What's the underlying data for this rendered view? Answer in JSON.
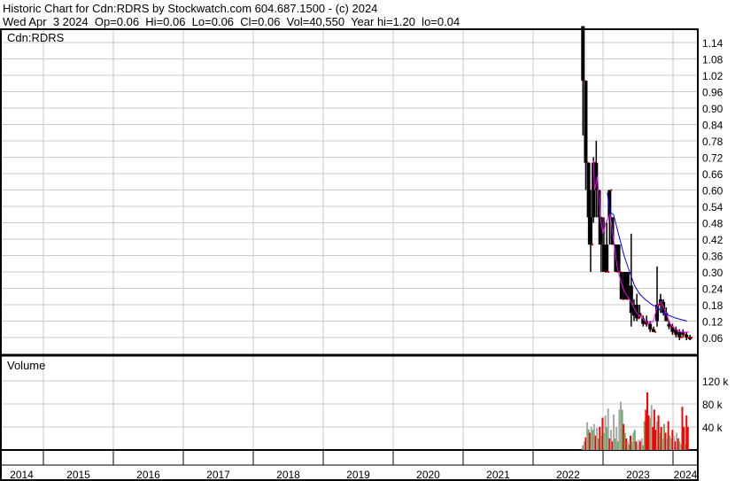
{
  "header": {
    "title": "Historic Chart for Cdn:RDRS by Stockwatch.com 604.687.1500 - (c) 2024",
    "quote": "Wed Apr  3 2024  Op=0.06  Hi=0.06  Lo=0.06  Cl=0.06  Vol=40,550  Year hi=1.20  lo=0.04"
  },
  "chart_data": [
    {
      "type": "ohlc",
      "title": "Cdn:RDRS",
      "ylim": [
        0.03,
        1.2
      ],
      "yticks": [
        "0.06",
        "0.12",
        "0.18",
        "0.24",
        "0.30",
        "0.36",
        "0.42",
        "0.48",
        "0.54",
        "0.60",
        "0.66",
        "0.72",
        "0.78",
        "0.84",
        "0.90",
        "0.96",
        "1.02",
        "1.08",
        "1.14"
      ],
      "bars": [
        [
          2022.7,
          1.2,
          0.8,
          1.2,
          1.0
        ],
        [
          2022.74,
          1.0,
          0.6,
          1.0,
          0.7
        ],
        [
          2022.78,
          0.7,
          0.4,
          0.7,
          0.5
        ],
        [
          2022.81,
          0.6,
          0.3,
          0.5,
          0.4
        ],
        [
          2022.85,
          0.72,
          0.48,
          0.5,
          0.7
        ],
        [
          2022.89,
          0.78,
          0.5,
          0.7,
          0.6
        ],
        [
          2022.93,
          0.6,
          0.4,
          0.6,
          0.5
        ],
        [
          2022.96,
          0.5,
          0.3,
          0.5,
          0.4
        ],
        [
          2023.0,
          0.5,
          0.3,
          0.4,
          0.3
        ],
        [
          2023.04,
          0.48,
          0.3,
          0.4,
          0.3
        ],
        [
          2023.08,
          0.6,
          0.4,
          0.5,
          0.6
        ],
        [
          2023.12,
          0.5,
          0.4,
          0.5,
          0.4
        ],
        [
          2023.17,
          0.4,
          0.3,
          0.4,
          0.3
        ],
        [
          2023.21,
          0.4,
          0.3,
          0.4,
          0.3
        ],
        [
          2023.25,
          0.3,
          0.2,
          0.3,
          0.2
        ],
        [
          2023.3,
          0.3,
          0.2,
          0.3,
          0.2
        ],
        [
          2023.34,
          0.3,
          0.2,
          0.3,
          0.2
        ],
        [
          2023.39,
          0.44,
          0.1,
          0.25,
          0.15
        ],
        [
          2023.43,
          0.2,
          0.12,
          0.18,
          0.14
        ],
        [
          2023.47,
          0.22,
          0.12,
          0.18,
          0.13
        ],
        [
          2023.51,
          0.18,
          0.13,
          0.15,
          0.14
        ],
        [
          2023.56,
          0.14,
          0.1,
          0.13,
          0.11
        ],
        [
          2023.61,
          0.14,
          0.1,
          0.12,
          0.11
        ],
        [
          2023.66,
          0.12,
          0.08,
          0.11,
          0.09
        ],
        [
          2023.71,
          0.1,
          0.08,
          0.09,
          0.08
        ],
        [
          2023.76,
          0.32,
          0.1,
          0.12,
          0.18
        ],
        [
          2023.81,
          0.22,
          0.15,
          0.2,
          0.18
        ],
        [
          2023.85,
          0.2,
          0.14,
          0.19,
          0.15
        ],
        [
          2023.89,
          0.17,
          0.12,
          0.15,
          0.12
        ],
        [
          2023.93,
          0.12,
          0.09,
          0.11,
          0.1
        ],
        [
          2023.98,
          0.11,
          0.07,
          0.1,
          0.08
        ],
        [
          2024.03,
          0.1,
          0.06,
          0.09,
          0.07
        ],
        [
          2024.08,
          0.09,
          0.05,
          0.08,
          0.06
        ],
        [
          2024.13,
          0.09,
          0.06,
          0.08,
          0.07
        ],
        [
          2024.18,
          0.08,
          0.05,
          0.07,
          0.06
        ],
        [
          2024.23,
          0.07,
          0.05,
          0.06,
          0.06
        ]
      ],
      "ma_short": {
        "color": "#ff00ff",
        "points": [
          [
            2022.86,
            0.71
          ],
          [
            2022.88,
            0.6
          ],
          [
            2022.92,
            0.65
          ],
          [
            2022.96,
            0.5
          ],
          [
            2023.0,
            0.44
          ],
          [
            2023.04,
            0.48
          ],
          [
            2023.1,
            0.51
          ],
          [
            2023.15,
            0.42
          ],
          [
            2023.2,
            0.32
          ],
          [
            2023.25,
            0.27
          ],
          [
            2023.3,
            0.23
          ],
          [
            2023.35,
            0.21
          ],
          [
            2023.4,
            0.19
          ],
          [
            2023.48,
            0.15
          ],
          [
            2023.56,
            0.13
          ],
          [
            2023.65,
            0.11
          ],
          [
            2023.72,
            0.12
          ],
          [
            2023.78,
            0.18
          ],
          [
            2023.83,
            0.19
          ],
          [
            2023.9,
            0.15
          ],
          [
            2023.96,
            0.11
          ],
          [
            2024.03,
            0.09
          ],
          [
            2024.12,
            0.08
          ],
          [
            2024.23,
            0.08
          ]
        ]
      },
      "ma_long": {
        "color": "#0000ff",
        "points": [
          [
            2023.06,
            0.59
          ],
          [
            2023.1,
            0.52
          ],
          [
            2023.15,
            0.51
          ],
          [
            2023.22,
            0.44
          ],
          [
            2023.3,
            0.36
          ],
          [
            2023.38,
            0.3
          ],
          [
            2023.45,
            0.25
          ],
          [
            2023.52,
            0.22
          ],
          [
            2023.6,
            0.2
          ],
          [
            2023.7,
            0.18
          ],
          [
            2023.78,
            0.17
          ],
          [
            2023.85,
            0.15
          ],
          [
            2023.95,
            0.14
          ],
          [
            2024.05,
            0.13
          ],
          [
            2024.2,
            0.12
          ]
        ]
      }
    },
    {
      "type": "bar",
      "title": "Volume",
      "ylim": [
        0,
        140
      ],
      "yticks": [
        "40 k",
        "80 k",
        "120 k"
      ],
      "yvals": [
        40,
        80,
        120
      ],
      "bars": [
        [
          2022.7,
          8,
          "#60b060"
        ],
        [
          2022.72,
          15,
          "#a8a8a8"
        ],
        [
          2022.74,
          22,
          "#ff0000"
        ],
        [
          2022.76,
          48,
          "#a8a8a8"
        ],
        [
          2022.78,
          36,
          "#60b060"
        ],
        [
          2022.8,
          30,
          "#ff0000"
        ],
        [
          2022.82,
          40,
          "#a8a8a8"
        ],
        [
          2022.84,
          35,
          "#60b060"
        ],
        [
          2022.86,
          45,
          "#a8a8a8"
        ],
        [
          2022.88,
          25,
          "#ff0000"
        ],
        [
          2022.9,
          38,
          "#a8a8a8"
        ],
        [
          2022.92,
          20,
          "#60b060"
        ],
        [
          2022.94,
          40,
          "#ff0000"
        ],
        [
          2022.96,
          25,
          "#a8a8a8"
        ],
        [
          2022.98,
          56,
          "#ff0000"
        ],
        [
          2023.0,
          30,
          "#60b060"
        ],
        [
          2023.02,
          60,
          "#a8a8a8"
        ],
        [
          2023.04,
          40,
          "#60b060"
        ],
        [
          2023.06,
          72,
          "#a8a8a8"
        ],
        [
          2023.08,
          20,
          "#ff0000"
        ],
        [
          2023.1,
          35,
          "#a8a8a8"
        ],
        [
          2023.12,
          15,
          "#ff0000"
        ],
        [
          2023.14,
          62,
          "#a8a8a8"
        ],
        [
          2023.16,
          20,
          "#60b060"
        ],
        [
          2023.18,
          40,
          "#a8a8a8"
        ],
        [
          2023.2,
          15,
          "#60b060"
        ],
        [
          2023.22,
          70,
          "#a8a8a8"
        ],
        [
          2023.24,
          84,
          "#a8a8a8"
        ],
        [
          2023.26,
          70,
          "#60b060"
        ],
        [
          2023.28,
          45,
          "#ff0000"
        ],
        [
          2023.3,
          30,
          "#60b060"
        ],
        [
          2023.32,
          20,
          "#ff0000"
        ],
        [
          2023.34,
          15,
          "#a8a8a8"
        ],
        [
          2023.36,
          10,
          "#60b060"
        ],
        [
          2023.38,
          25,
          "#ff0000"
        ],
        [
          2023.4,
          15,
          "#60b060"
        ],
        [
          2023.42,
          30,
          "#a8a8a8"
        ],
        [
          2023.44,
          35,
          "#60b060"
        ],
        [
          2023.46,
          15,
          "#ff0000"
        ],
        [
          2023.48,
          10,
          "#a8a8a8"
        ],
        [
          2023.5,
          18,
          "#a8a8a8"
        ],
        [
          2023.52,
          15,
          "#ff0000"
        ],
        [
          2023.54,
          20,
          "#a8a8a8"
        ],
        [
          2023.56,
          8,
          "#60b060"
        ],
        [
          2023.58,
          50,
          "#60b060"
        ],
        [
          2023.6,
          70,
          "#ff0000"
        ],
        [
          2023.62,
          100,
          "#ff0000"
        ],
        [
          2023.64,
          60,
          "#ff0000"
        ],
        [
          2023.66,
          55,
          "#60b060"
        ],
        [
          2023.68,
          78,
          "#a8a8a8"
        ],
        [
          2023.7,
          40,
          "#ff0000"
        ],
        [
          2023.72,
          70,
          "#ff0000"
        ],
        [
          2023.74,
          35,
          "#ff0000"
        ],
        [
          2023.76,
          50,
          "#a8a8a8"
        ],
        [
          2023.78,
          60,
          "#ff0000"
        ],
        [
          2023.8,
          30,
          "#60b060"
        ],
        [
          2023.82,
          40,
          "#ff0000"
        ],
        [
          2023.84,
          20,
          "#a8a8a8"
        ],
        [
          2023.86,
          45,
          "#60b060"
        ],
        [
          2023.88,
          30,
          "#ff0000"
        ],
        [
          2023.9,
          20,
          "#a8a8a8"
        ],
        [
          2023.92,
          50,
          "#ff0000"
        ],
        [
          2023.94,
          25,
          "#60b060"
        ],
        [
          2023.96,
          20,
          "#a8a8a8"
        ],
        [
          2023.98,
          35,
          "#ff0000"
        ],
        [
          2024.0,
          25,
          "#a8a8a8"
        ],
        [
          2024.02,
          15,
          "#ff0000"
        ],
        [
          2024.04,
          30,
          "#a8a8a8"
        ],
        [
          2024.06,
          20,
          "#ff0000"
        ],
        [
          2024.08,
          15,
          "#60b060"
        ],
        [
          2024.1,
          10,
          "#a8a8a8"
        ],
        [
          2024.12,
          75,
          "#ff0000"
        ],
        [
          2024.14,
          40,
          "#ff0000"
        ],
        [
          2024.16,
          10,
          "#60b060"
        ],
        [
          2024.18,
          60,
          "#ff0000"
        ],
        [
          2024.2,
          40,
          "#ff0000"
        ]
      ]
    }
  ],
  "xaxis": {
    "years": [
      "2014",
      "2015",
      "2016",
      "2017",
      "2018",
      "2019",
      "2020",
      "2021",
      "2022",
      "2023",
      "2024"
    ]
  }
}
